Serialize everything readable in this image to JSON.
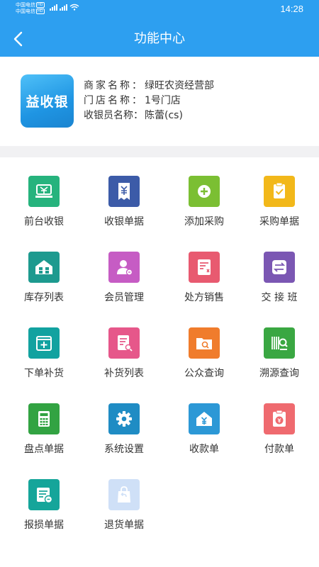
{
  "status_bar": {
    "carrier_1": "中国电信",
    "carrier_2": "中国电信",
    "hd": "HD",
    "signal": "⁴⁶ᵢₗ ⁴⁶ᵢₗ",
    "time": "14:28"
  },
  "header": {
    "title": "功能中心"
  },
  "merchant": {
    "logo_text": "益收银",
    "merchant_label": "商家名称：",
    "merchant_value": "绿旺农资经营部",
    "store_label": "门店名称：",
    "store_value": "1号门店",
    "cashier_label": "收银员名称：",
    "cashier_value": "陈蕾(cs)"
  },
  "functions": [
    {
      "label": "前台收银",
      "icon": "cashier-desk-icon",
      "color": "#26b37d"
    },
    {
      "label": "收银单据",
      "icon": "cash-receipt-icon",
      "color": "#3c5ba8"
    },
    {
      "label": "添加采购",
      "icon": "add-purchase-icon",
      "color": "#7bbf33"
    },
    {
      "label": "采购单据",
      "icon": "purchase-receipt-icon",
      "color": "#f2b81a"
    },
    {
      "label": "库存列表",
      "icon": "warehouse-icon",
      "color": "#1d9a8f"
    },
    {
      "label": "会员管理",
      "icon": "member-icon",
      "color": "#c65cc4"
    },
    {
      "label": "处方销售",
      "icon": "prescription-icon",
      "color": "#e85a70"
    },
    {
      "label": "交 接 班",
      "icon": "shift-handover-icon",
      "color": "#7b57b3"
    },
    {
      "label": "下单补货",
      "icon": "replenish-order-icon",
      "color": "#12a2a0"
    },
    {
      "label": "补货列表",
      "icon": "replenish-list-icon",
      "color": "#e6578a"
    },
    {
      "label": "公众查询",
      "icon": "public-query-icon",
      "color": "#f07c2c"
    },
    {
      "label": "溯源查询",
      "icon": "trace-query-icon",
      "color": "#3aa742"
    },
    {
      "label": "盘点单据",
      "icon": "calculator-icon",
      "color": "#32a342"
    },
    {
      "label": "系统设置",
      "icon": "gear-icon",
      "color": "#1f8cc4"
    },
    {
      "label": "收款单",
      "icon": "payment-received-icon",
      "color": "#2c98d6"
    },
    {
      "label": "付款单",
      "icon": "payment-sent-icon",
      "color": "#ef6a6f"
    },
    {
      "label": "报损单据",
      "icon": "loss-report-icon",
      "color": "#15a59a"
    },
    {
      "label": "退货单据",
      "icon": "return-goods-icon",
      "color": "#cfe0f7"
    }
  ]
}
